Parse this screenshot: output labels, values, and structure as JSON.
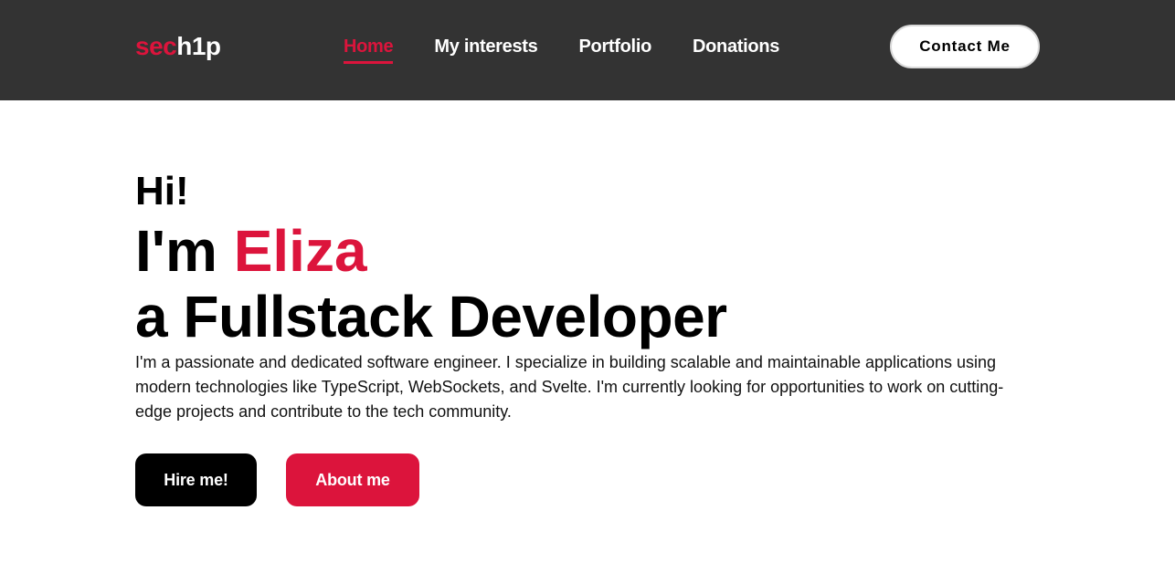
{
  "colors": {
    "accent": "#dc143c",
    "navbar_bg": "#333333",
    "text": "#000000",
    "background": "#ffffff"
  },
  "header": {
    "logo": {
      "accent_part": "sec",
      "rest_part": "h1p"
    },
    "nav_items": [
      {
        "label": "Home",
        "active": true
      },
      {
        "label": "My interests",
        "active": false
      },
      {
        "label": "Portfolio",
        "active": false
      },
      {
        "label": "Donations",
        "active": false
      }
    ],
    "contact_label": "Contact Me"
  },
  "hero": {
    "greeting": "Hi!",
    "intro_prefix": "I'm",
    "name": "Eliza",
    "role": "a Fullstack Developer",
    "description": "I'm a passionate and dedicated software engineer. I specialize in building scalable and maintainable applications using modern technologies like TypeScript, WebSockets, and Svelte. I'm currently looking for opportunities to work on cutting-edge projects and contribute to the tech community.",
    "hire_label": "Hire me!",
    "about_label": "About me"
  }
}
